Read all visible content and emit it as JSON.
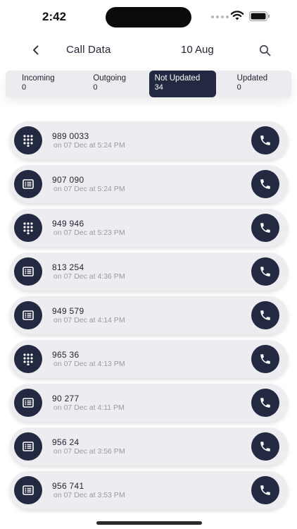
{
  "status_bar": {
    "time": "2:42",
    "icons": [
      "signal-icon",
      "wifi-icon",
      "battery-icon"
    ]
  },
  "header": {
    "back_icon": "chevron-left-icon",
    "title": "Call Data",
    "date": "10 Aug",
    "search_icon": "search-icon"
  },
  "tabs": [
    {
      "label": "Incoming",
      "count": "0",
      "active": false
    },
    {
      "label": "Outgoing",
      "count": "0",
      "active": false
    },
    {
      "label": "Not Updated",
      "count": "34",
      "active": true
    },
    {
      "label": "Updated",
      "count": "0",
      "active": false
    }
  ],
  "colors": {
    "accent": "#232941",
    "row_bg": "#ececf1",
    "secondary_text": "#9a9aa4"
  },
  "calls": [
    {
      "number": "989      0033",
      "time": "on 07 Dec at 5:24 PM",
      "type_icon": "dialpad-icon"
    },
    {
      "number": "907        090",
      "time": "on 07 Dec at 5:24 PM",
      "type_icon": "list-icon"
    },
    {
      "number": "949        946",
      "time": "on 07 Dec at 5:23 PM",
      "type_icon": "dialpad-icon"
    },
    {
      "number": "813        254",
      "time": "on 07 Dec at 4:36 PM",
      "type_icon": "list-icon"
    },
    {
      "number": "949       579",
      "time": "on 07 Dec at 4:14 PM",
      "type_icon": "list-icon"
    },
    {
      "number": "965          36",
      "time": "on 07 Dec at 4:13 PM",
      "type_icon": "dialpad-icon"
    },
    {
      "number": "90          277",
      "time": "on 07 Dec at 4:11 PM",
      "type_icon": "list-icon"
    },
    {
      "number": "956          24",
      "time": "on 07 Dec at 3:56 PM",
      "type_icon": "list-icon"
    },
    {
      "number": "956         741",
      "time": "on 07 Dec at 3:53 PM",
      "type_icon": "list-icon"
    }
  ]
}
